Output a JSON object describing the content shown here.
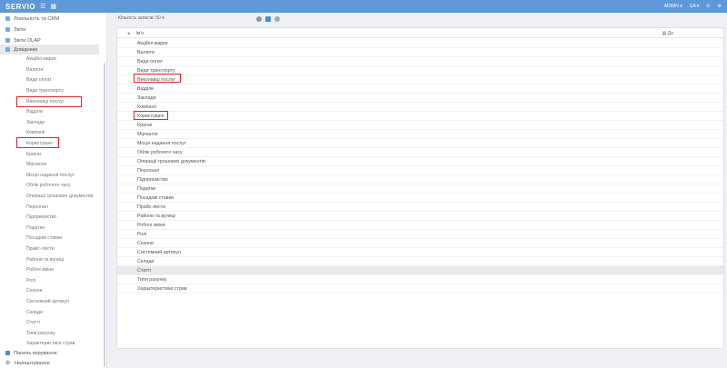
{
  "header": {
    "logo": "SERVIO",
    "user": "ADMIN",
    "lang": "UA",
    "menu_icon": "hamburger-icon",
    "calendar_icon": "calendar-icon",
    "phone_icon": "phone-icon",
    "settings_icon": "gear-icon"
  },
  "sidebar": {
    "top_items": [
      {
        "label": "Лояльність та CRM"
      },
      {
        "label": "Звіти"
      },
      {
        "label": "Звіти OLAP"
      },
      {
        "label": "Довідники"
      }
    ],
    "sub_items": [
      "Акційні марки",
      "Валюти",
      "Види оплат",
      "Види транспорту",
      "Виконавці послуг",
      "Відділи",
      "Заклади",
      "Компанії",
      "Користувачі",
      "Країни",
      "Мірчанти",
      "Місця надання послуг",
      "Облік робочого часу",
      "Операції грошових документів",
      "Персонал",
      "Підприємство",
      "Податки",
      "Посадові ставки",
      "Прайс-листи",
      "Райони та вулиці",
      "Робочі зміни",
      "Ролі",
      "Сезони",
      "Системний артикул",
      "Склади",
      "Статті",
      "Типи рахунку",
      "Характеристики страв"
    ],
    "bottom_items": [
      {
        "label": "Панель керування"
      },
      {
        "label": "Налаштування"
      }
    ]
  },
  "toolbar": {
    "selector_label": "Кількість записів: 50 ▾"
  },
  "table": {
    "col_name": "Ім'я",
    "col_do": "До",
    "rows": [
      "Акційні марки",
      "Валюти",
      "Види оплат",
      "Види транспорту",
      "Виконавці послуг",
      "Відділи",
      "Заклади",
      "Компанії",
      "Користувачі",
      "Країни",
      "Мірчанти",
      "Місця надання послуг",
      "Облік робочого часу",
      "Операції грошових документів",
      "Персонал",
      "Підприємство",
      "Податки",
      "Посадові ставки",
      "Прайс-листи",
      "Райони та вулиці",
      "Робочі зміни",
      "Ролі",
      "Сезони",
      "Системний артикул",
      "Склади",
      "Статті",
      "Типи рахунку",
      "Характеристики страв"
    ],
    "highlighted_row": "Статті"
  },
  "colors": {
    "header_bg": "#5e98d8",
    "annotation": "#e0262d"
  }
}
